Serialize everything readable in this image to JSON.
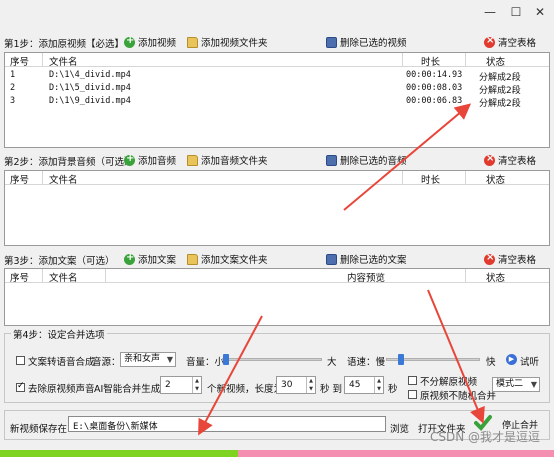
{
  "step1": {
    "label": "第1步：添加原视频【必选】",
    "buttons": {
      "add": "添加视频",
      "add_folder": "添加视频文件夹",
      "delete": "删除已选的视频",
      "clear": "清空表格"
    },
    "columns": [
      "序号",
      "文件名",
      "时长",
      "状态"
    ],
    "rows": [
      {
        "index": "1",
        "file": "D:\\1\\4_divid.mp4",
        "duration": "00:00:14.93",
        "status": "分解成2段"
      },
      {
        "index": "2",
        "file": "D:\\1\\5_divid.mp4",
        "duration": "00:00:08.03",
        "status": "分解成2段"
      },
      {
        "index": "3",
        "file": "D:\\1\\9_divid.mp4",
        "duration": "00:00:06.83",
        "status": "分解成2段"
      }
    ]
  },
  "step2": {
    "label": "第2步：添加背景音频（可选）",
    "buttons": {
      "add": "添加音频",
      "add_folder": "添加音频文件夹",
      "delete": "删除已选的音频",
      "clear": "清空表格"
    },
    "columns": [
      "序号",
      "文件名",
      "时长",
      "状态"
    ]
  },
  "step3": {
    "label": "第3步：添加文案（可选）",
    "buttons": {
      "add": "添加文案",
      "add_folder": "添加文案文件夹",
      "delete": "删除已选的文案",
      "clear": "清空表格"
    },
    "columns": [
      "序号",
      "文件名",
      "内容预览",
      "状态"
    ]
  },
  "step4": {
    "label": "第4步：设定合并选项",
    "tts_label": "文案转语音合成",
    "voice_label": "音源：",
    "voice_value": "亲和女声",
    "volume_label": "音量：小",
    "volume_max": "大",
    "speed_label": "语速：慢",
    "speed_max": "快",
    "trial_label": "试听",
    "remove_audio_label": "去除原视频声音",
    "ai_label": "AI智能合并生成：",
    "count_value": "2",
    "count_suffix": "个新视频，长度为：",
    "len_from": "30",
    "to_label": "秒 到",
    "len_to": "45",
    "sec_label": "秒",
    "no_split_label": "不分解原视频",
    "no_random_label": "原视频不随机合并",
    "mode_value": "模式二"
  },
  "save": {
    "label": "新视频保存在：",
    "path": "E:\\桌面备份\\新媒体",
    "browse": "浏览",
    "open_folder": "打开文件夹",
    "stop": "停止合并"
  },
  "watermark": "CSDN @我才是逗逗",
  "progress_fraction": 0.43,
  "colors": {
    "progress_done": "#7ed321",
    "progress_rest": "#f48fb1",
    "arrow": "#e8463a"
  }
}
